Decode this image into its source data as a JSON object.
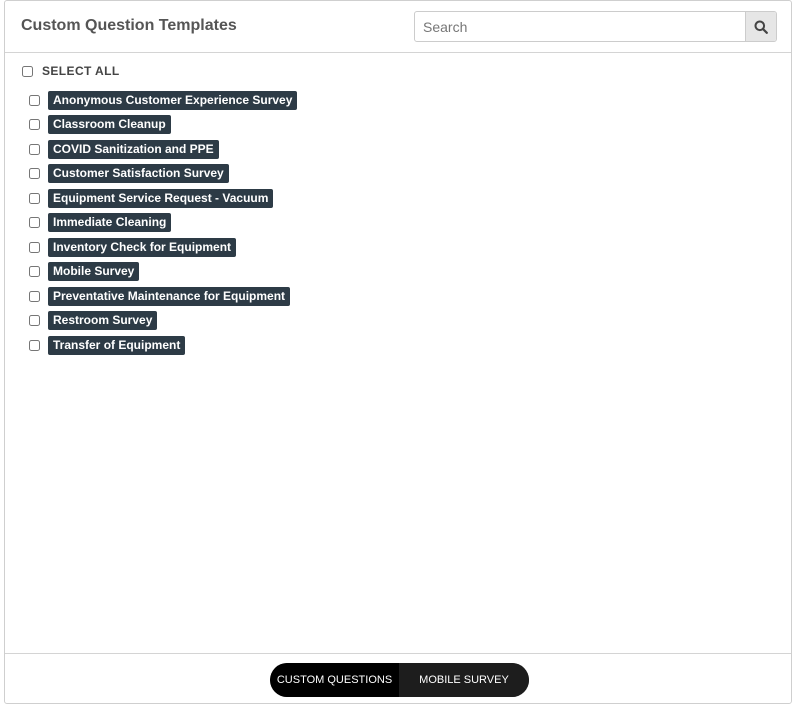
{
  "header": {
    "title": "Custom Question Templates",
    "search_placeholder": "Search",
    "search_value": ""
  },
  "select_all_label": "SELECT ALL",
  "templates": [
    "Anonymous Customer Experience Survey",
    "Classroom Cleanup",
    "COVID Sanitization and PPE",
    "Customer Satisfaction Survey",
    "Equipment Service Request - Vacuum",
    "Immediate Cleaning",
    "Inventory Check for Equipment",
    "Mobile Survey",
    "Preventative Maintenance for Equipment",
    "Restroom Survey",
    "Transfer of Equipment"
  ],
  "footer": {
    "tab_custom_questions": "CUSTOM QUESTIONS",
    "tab_mobile_survey": "MOBILE SURVEY",
    "active_tab": "CUSTOM QUESTIONS"
  },
  "colors": {
    "tag_background": "#2d3b46",
    "toggle_background": "#111111"
  },
  "icons": {
    "search": "search-icon"
  }
}
